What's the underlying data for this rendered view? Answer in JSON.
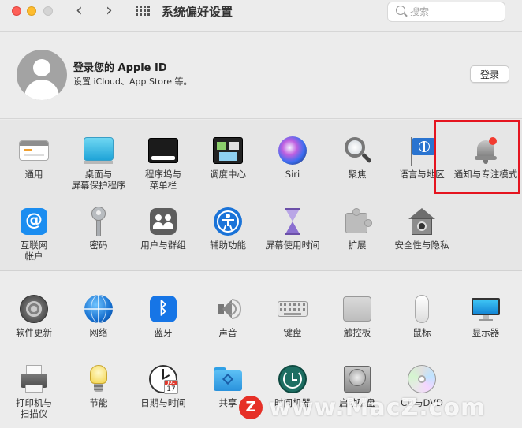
{
  "window": {
    "title": "系统偏好设置",
    "search_placeholder": "搜索"
  },
  "account": {
    "title": "登录您的 Apple ID",
    "subtitle": "设置 iCloud、App Store 等。",
    "login_label": "登录"
  },
  "panes_row1": [
    {
      "label": "通用"
    },
    {
      "label": "桌面与\n屏幕保护程序"
    },
    {
      "label": "程序坞与\n菜单栏"
    },
    {
      "label": "调度中心"
    },
    {
      "label": "Siri"
    },
    {
      "label": "聚焦"
    },
    {
      "label": "语言与地区"
    },
    {
      "label": "通知与专注模式"
    }
  ],
  "panes_row2": [
    {
      "label": "互联网\n帐户"
    },
    {
      "label": "密码"
    },
    {
      "label": "用户与群组"
    },
    {
      "label": "辅助功能"
    },
    {
      "label": "屏幕使用时间"
    },
    {
      "label": "扩展"
    },
    {
      "label": "安全性与隐私"
    }
  ],
  "panes_row3": [
    {
      "label": "软件更新"
    },
    {
      "label": "网络"
    },
    {
      "label": "蓝牙"
    },
    {
      "label": "声音"
    },
    {
      "label": "键盘"
    },
    {
      "label": "触控板"
    },
    {
      "label": "鼠标"
    },
    {
      "label": "显示器"
    }
  ],
  "panes_row4": [
    {
      "label": "打印机与\n扫描仪"
    },
    {
      "label": "节能"
    },
    {
      "label": "日期与时间"
    },
    {
      "label": "共享"
    },
    {
      "label": "时间机器"
    },
    {
      "label": "启动磁盘"
    },
    {
      "label": "CD与DVD"
    }
  ],
  "calendar_icon": {
    "month": "JUL",
    "day": "17"
  },
  "watermark": {
    "logo": "Z",
    "text": "www.MacZ.com"
  },
  "colors": {
    "highlight": "#e5141f",
    "accent": "#1e88e5"
  }
}
